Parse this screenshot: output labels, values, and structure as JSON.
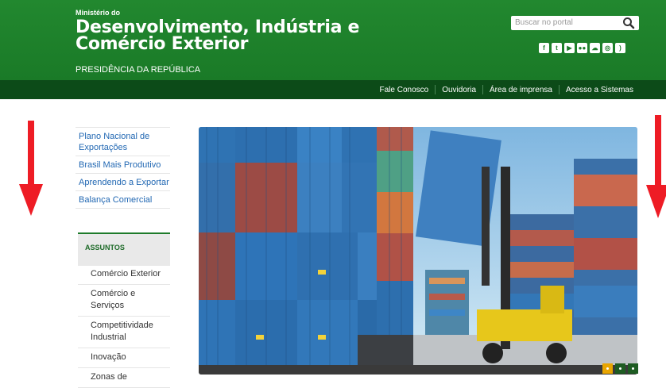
{
  "header": {
    "pretitle": "Ministério do",
    "title_line1": "Desenvolvimento, Indústria e",
    "title_line2": "Comércio Exterior",
    "subtitle": "PRESIDÊNCIA DA REPÚBLICA",
    "search_placeholder": "Buscar no portal",
    "social_icons": [
      "facebook-icon",
      "twitter-icon",
      "youtube-icon",
      "flickr-icon",
      "soundcloud-icon",
      "instagram-icon",
      "rss-icon"
    ]
  },
  "topnav": {
    "links": [
      "Fale Conosco",
      "Ouvidoria",
      "Área de imprensa",
      "Acesso a Sistemas"
    ]
  },
  "leftnav": {
    "items": [
      "Plano Nacional de Exportações",
      "Brasil Mais Produtivo",
      "Aprendendo a Exportar",
      "Balança Comercial"
    ]
  },
  "assuntos": {
    "heading": "ASSUNTOS",
    "items": [
      "Comércio Exterior",
      "Comércio e Serviços",
      "Competitividade Industrial",
      "Inovação",
      "Zonas de"
    ]
  },
  "colors": {
    "header_green": "#1a7a27",
    "nav_dark_green": "#0c4b18",
    "link_blue": "#2268b3",
    "arrow_red": "#ee1c25",
    "slider_active": "#e8a500"
  },
  "hero": {
    "image": "shipping-containers-photo",
    "slides": 3,
    "active_slide": 1
  }
}
